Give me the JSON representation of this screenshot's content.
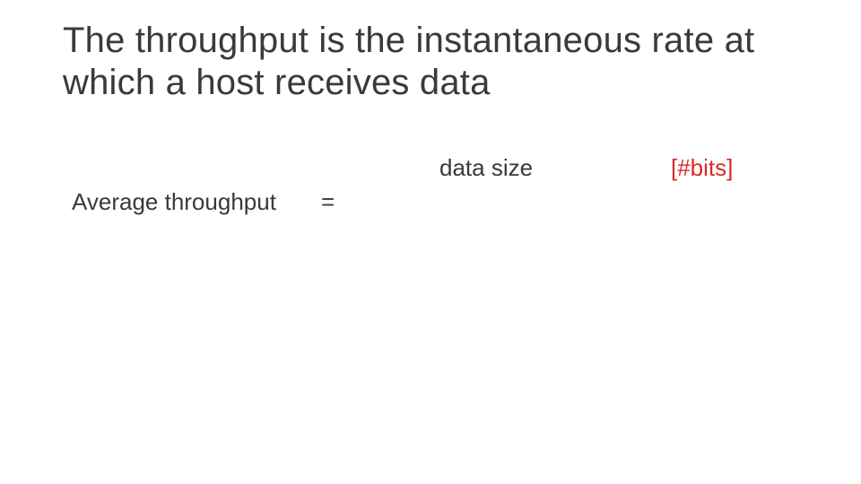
{
  "title": "The throughput is the instantaneous rate at which a host receives data",
  "formula": {
    "lhs": "Average throughput",
    "eq": "=",
    "numerator": "data size",
    "unit": "[#bits]"
  }
}
